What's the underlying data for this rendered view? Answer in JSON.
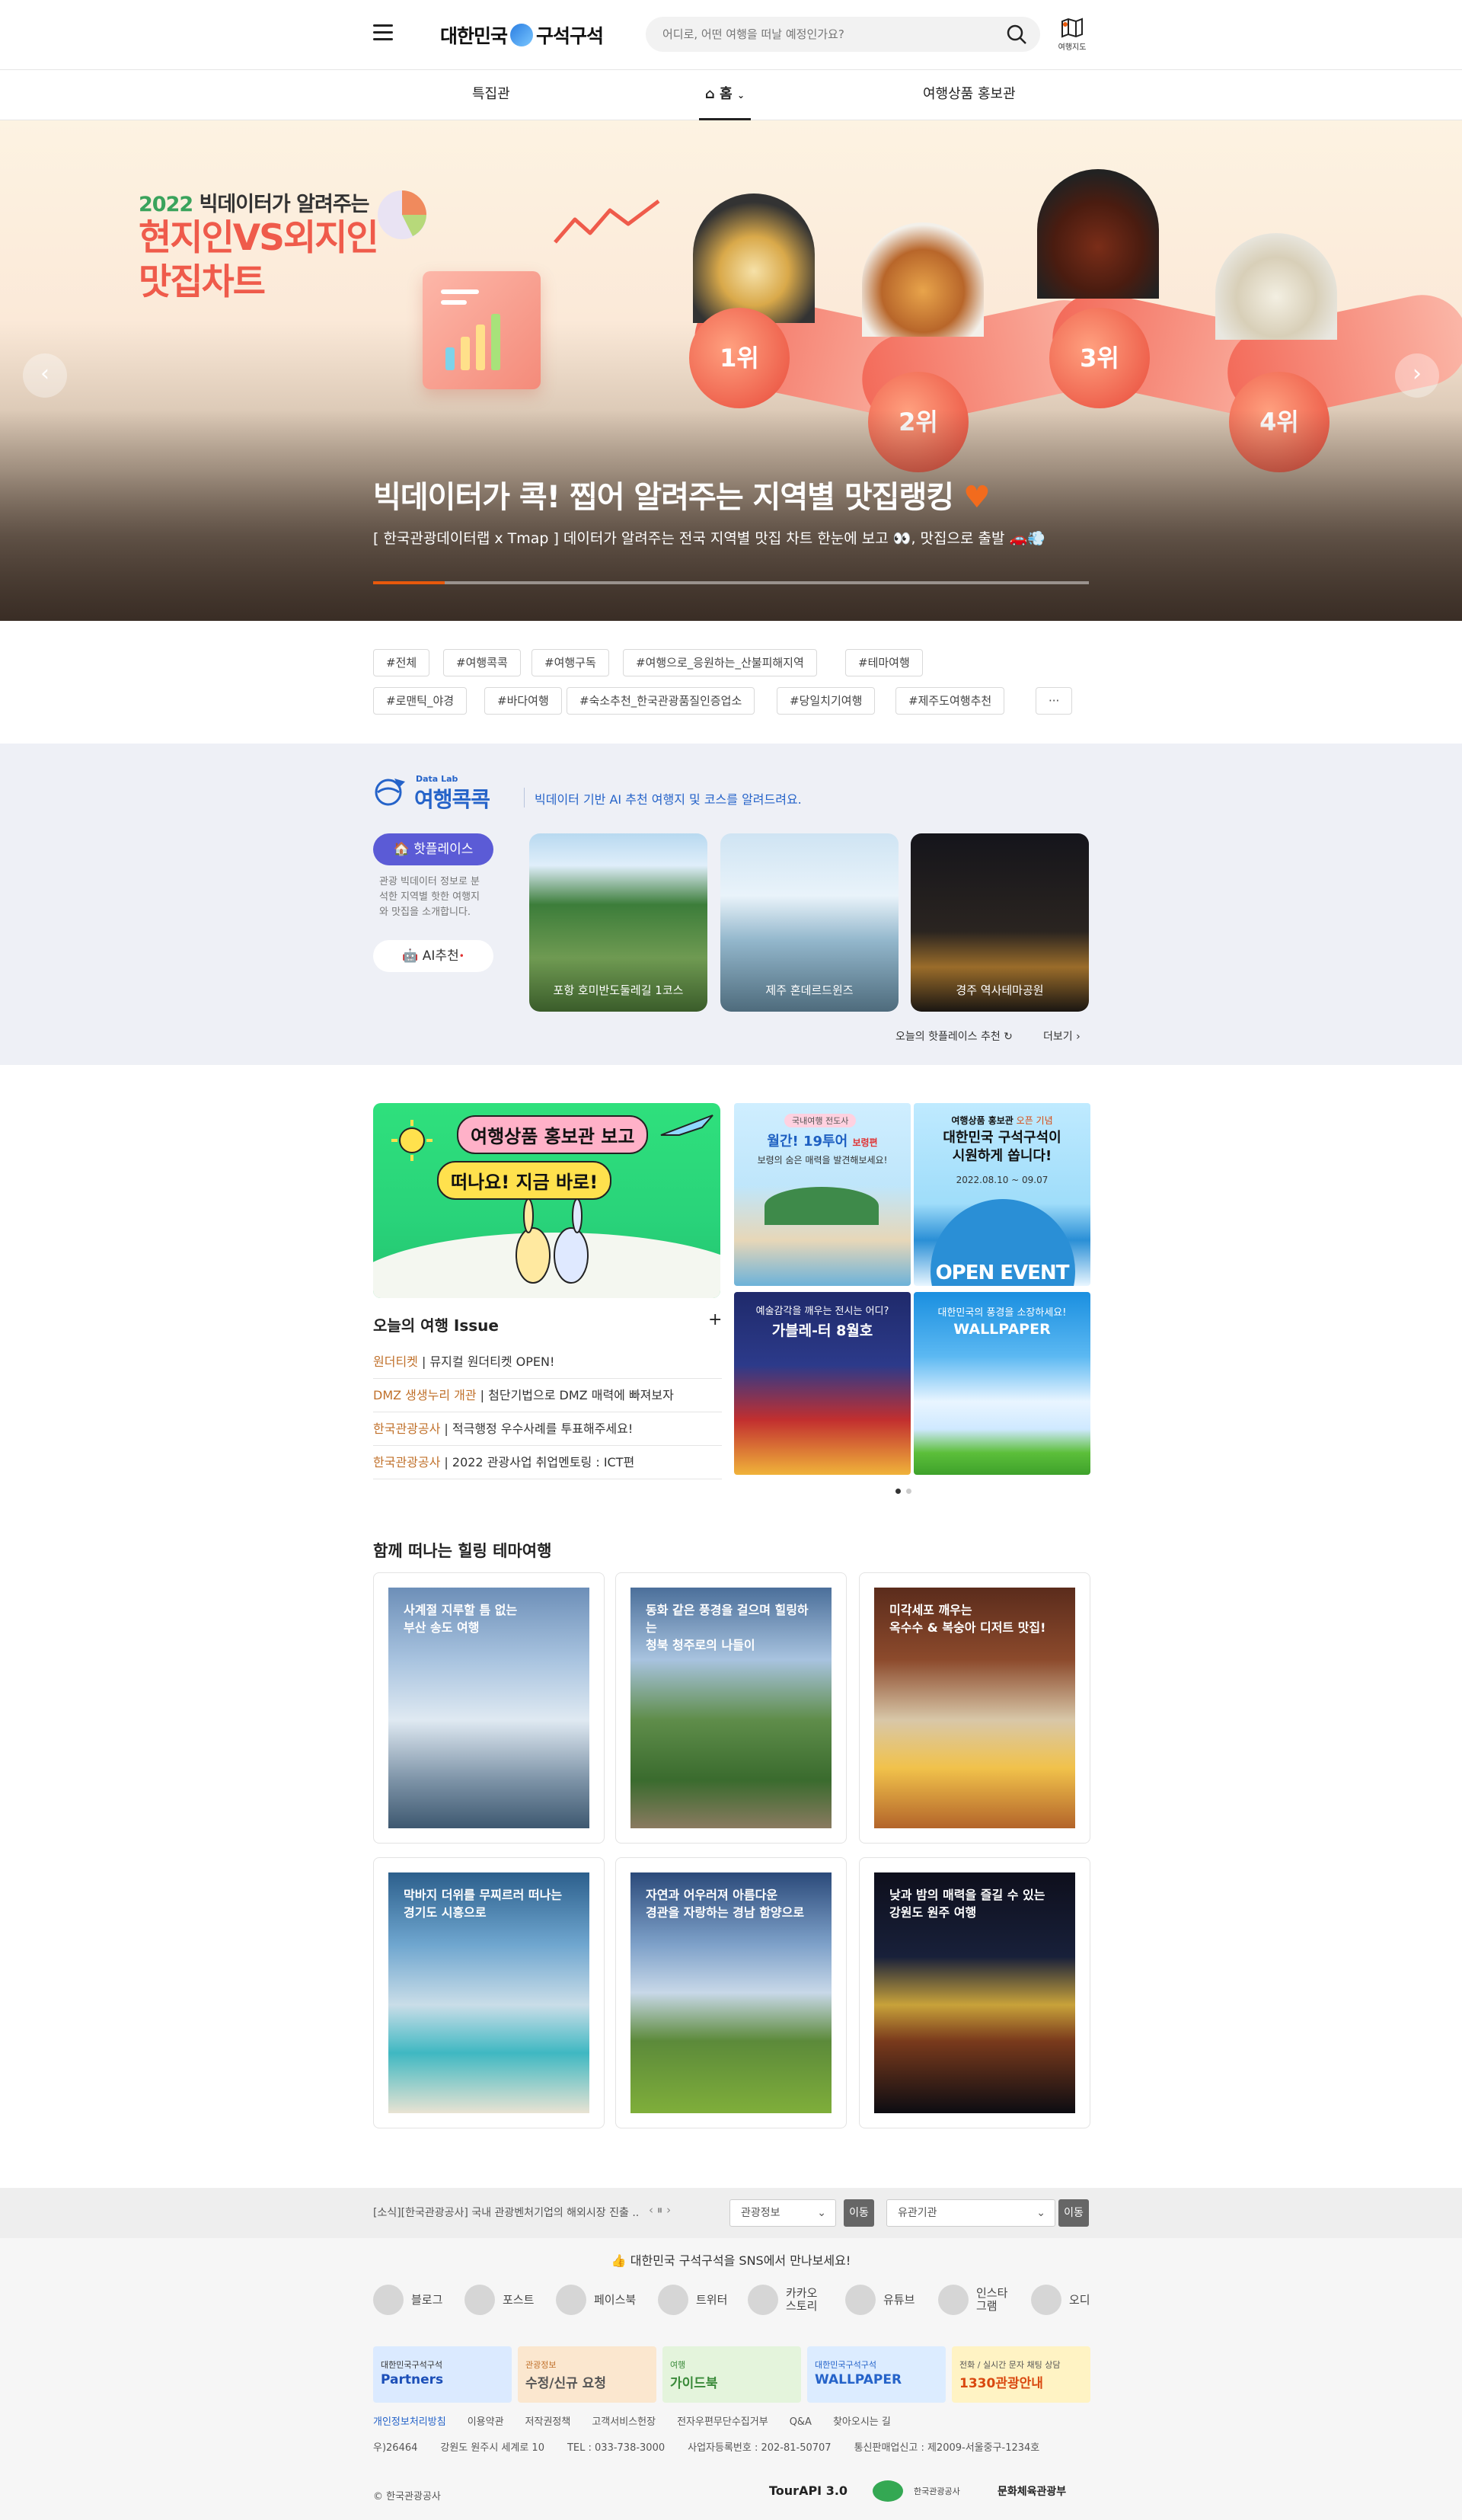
{
  "header": {
    "logo_left": "대한민국",
    "logo_right": "구석구석",
    "search_placeholder": "어디로, 어떤 여행을 떠날 예정인가요?",
    "map_label": "여행지도"
  },
  "nav": {
    "items": [
      "특집관",
      "홈",
      "여행상품 홍보관"
    ]
  },
  "hero": {
    "year": "2022",
    "kicker": "빅데이터가 알려주는",
    "headline1": "현지인VS외지인",
    "headline2": "맛집차트",
    "ranks": [
      "1위",
      "2위",
      "3위",
      "4위"
    ],
    "title": "빅데이터가 콕! 찝어 알려주는 지역별 맛집랭킹",
    "subtitle": "[ 한국관광데이터랩 x Tmap ] 데이터가 알려주는 전국 지역별 맛집 차트 한눈에 보고 👀, 맛집으로 출발 🚗💨",
    "progress": 0.1
  },
  "tags": [
    "#전체",
    "#여행콕콕",
    "#여행구독",
    "#여행으로_응원하는_산불피해지역",
    "#테마여행",
    "#로맨틱_야경",
    "#바다여행",
    "#숙소추천_한국관광품질인증업소",
    "#당일치기여행",
    "#제주도여행추천",
    "···"
  ],
  "datalab": {
    "badge": "Data Lab",
    "title": "여행콕콕",
    "desc": "빅데이터 기반 AI 추천 여행지 및 코스를 알려드려요.",
    "hot_label": "핫플레이스",
    "hot_desc": "관광 빅데이터 정보로 분석한 지역별 핫한 여행지와 맛집을 소개합니다.",
    "ai_label": "AI추천",
    "cards": [
      "포항 호미반도둘레길 1코스",
      "제주 혼데르드윈즈",
      "경주 역사테마공원"
    ],
    "today": "오늘의 핫플레이스 추천",
    "more": "더보기"
  },
  "promo": {
    "line1": "여행상품 홍보관 보고",
    "line2": "떠나요! 지금 바로!"
  },
  "issue": {
    "title": "오늘의 여행 Issue",
    "plus": "+",
    "items": [
      {
        "src": "원더티켓",
        "text": "뮤지컬 원더티켓 OPEN!"
      },
      {
        "src": "DMZ 생생누리 개관",
        "text": "첨단기법으로 DMZ 매력에 빠져보자"
      },
      {
        "src": "한국관광공사",
        "text": "적극행정 우수사례를 투표해주세요!"
      },
      {
        "src": "한국관광공사",
        "text": "2022 관광사업 취업멘토링 : ICT편"
      }
    ]
  },
  "tiles": {
    "t1_badge": "국내여행 전도사",
    "t1_title": "월간! 19투어",
    "t1_tag": "보령편",
    "t1_desc": "보령의 숨은 매력을 발견해보세요!",
    "t2_top": "여행상품 홍보관",
    "t2_top2": "오픈 기념",
    "t2_title1": "대한민국 구석구석이",
    "t2_title2": "시원하게 쏩니다!",
    "t2_date": "2022.08.10 ~ 09.07",
    "t2_event": "OPEN EVENT",
    "t3_q": "예술감각을 깨우는 전시는 어디?",
    "t3_title": "가블레-터 8월호",
    "t4_q": "대한민국의 풍경을 소장하세요!",
    "t4_title": "WALLPAPER"
  },
  "theme": {
    "title": "함께 떠나는 힐링 테마여행",
    "cards": [
      {
        "line1": "사계절 지루할 틈 없는",
        "line2": "부산 송도 여행"
      },
      {
        "line1": "동화 같은 풍경을 걸으며 힐링하는",
        "line2": "청북 청주로의 나들이"
      },
      {
        "line1": "미각세포 깨우는",
        "line2": "옥수수 & 복숭아 디저트 맛집!"
      },
      {
        "line1": "막바지 더위를 무찌르러 떠나는",
        "line2": "경기도 시흥으로"
      },
      {
        "line1": "자연과 어우러져 아름다운",
        "line2": "경관을 자랑하는 경남 함양으로"
      },
      {
        "line1": "낮과 밤의 매력을 즐길 수 있는",
        "line2": "강원도 원주 여행"
      }
    ]
  },
  "footer": {
    "notice": "[소식][한국관광공사] 국내 관광벤처기업의 해외시장 진출 ...",
    "sel1": "관광정보",
    "sel2": "유관기관",
    "go": "이동",
    "sns_title": "대한민국 구석구석을 SNS에서 만나보세요!",
    "sns": [
      {
        "icon": "blog",
        "label": "블로그"
      },
      {
        "icon": "post",
        "label": "포스트"
      },
      {
        "icon": "facebook",
        "label": "페이스북"
      },
      {
        "icon": "twitter",
        "label": "트위터"
      },
      {
        "icon": "kakao",
        "label": "카카오\n스토리"
      },
      {
        "icon": "youtube",
        "label": "유튜브"
      },
      {
        "icon": "instagram",
        "label": "인스타\n그램"
      },
      {
        "icon": "odii",
        "label": "오디"
      }
    ],
    "banners": [
      {
        "top": "대한민국구석구석",
        "main": "Partners"
      },
      {
        "top": "관광정보",
        "main": "수정/신규 요청"
      },
      {
        "top": "여행",
        "main": "가이드북"
      },
      {
        "top": "대한민국구석구석",
        "main": "WALLPAPER"
      },
      {
        "top": "전화 / 실시간 문자 채팅 상담",
        "main": "1330관광안내"
      }
    ],
    "links": [
      "개인정보처리방침",
      "이용약관",
      "저작권정책",
      "고객서비스헌장",
      "전자우편무단수집거부",
      "Q&A",
      "찾아오시는 길"
    ],
    "addr": [
      "우)26464",
      "강원도 원주시 세계로 10",
      "TEL : 033-738-3000",
      "사업자등록번호 : 202-81-50707",
      "통신판매업신고 : 제2009-서울중구-1234호"
    ],
    "copy": "© 한국관광공사",
    "logos": [
      "TourAPI 3.0",
      "한국관광공사",
      "문화체육관광부"
    ]
  },
  "colors": {
    "accent": "#e8590c",
    "purple": "#5b5bd6",
    "coral": "#ef5b4b",
    "green": "#2ecc71"
  }
}
